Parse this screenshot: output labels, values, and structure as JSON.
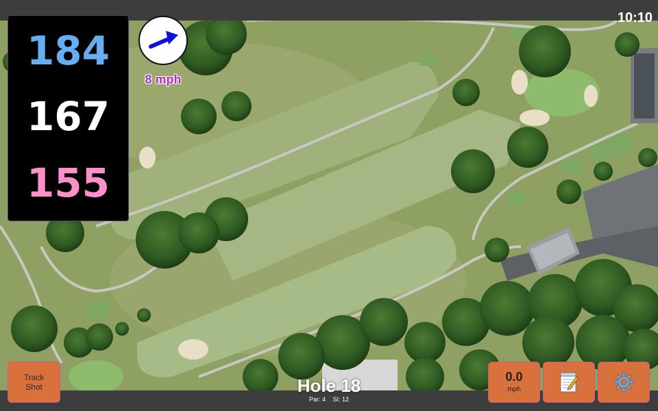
{
  "status": {
    "time": "10:10"
  },
  "distances": {
    "back": "184",
    "center": "167",
    "front": "155"
  },
  "wind": {
    "speed": "8 mph",
    "direction_icon": "arrow-right-icon",
    "color": "#b12fb9"
  },
  "hole": {
    "title": "Hole 18",
    "par": "Par: 4",
    "stroke_index": "SI: 12"
  },
  "buttons": {
    "track_shot": {
      "line1": "Track",
      "line2": "Shot"
    },
    "speed": {
      "value": "0.0",
      "unit": "mph"
    },
    "notes_icon": "notepad-icon",
    "settings_icon": "gear-icon"
  },
  "colors": {
    "button_bg": "#d9713c",
    "back_distance": "#67aef0",
    "center_distance": "#ffffff",
    "front_distance": "#ff8fc8",
    "panel_bg": "#000000"
  }
}
